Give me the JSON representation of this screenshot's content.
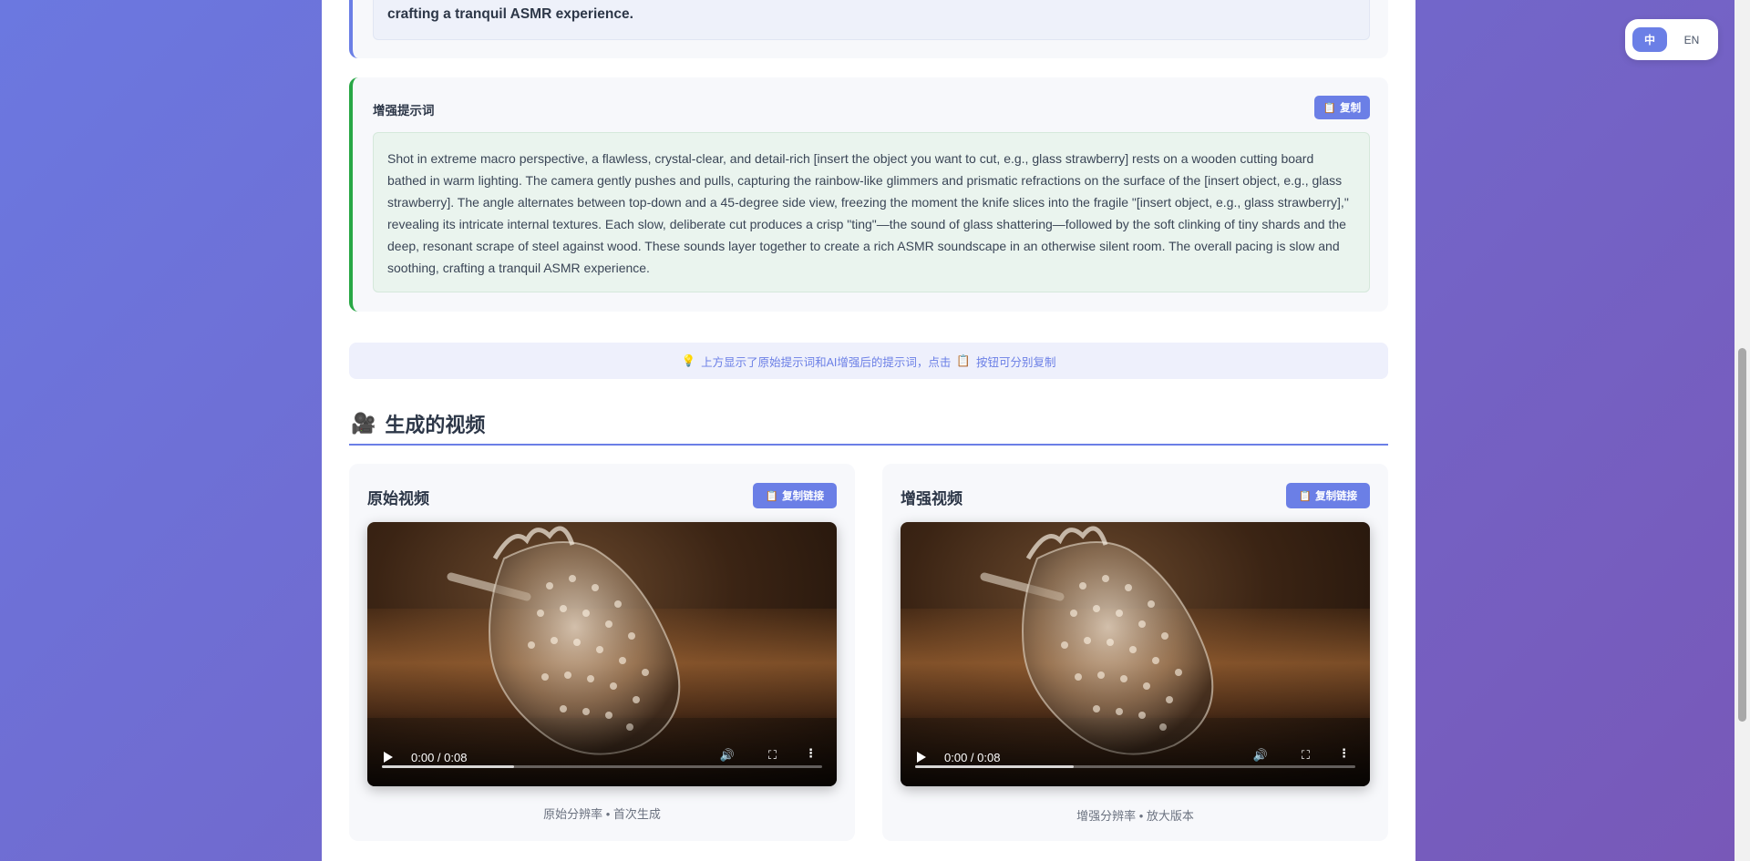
{
  "lang": {
    "zh": "中",
    "en": "EN"
  },
  "original_prompt": {
    "tail_text": "crafting a tranquil ASMR experience."
  },
  "enhanced": {
    "title": "增强提示词",
    "copy_icon": "clipboard-icon",
    "copy_label": "复制",
    "text": "Shot in extreme macro perspective, a flawless, crystal-clear, and detail-rich [insert the object you want to cut, e.g., glass strawberry] rests on a wooden cutting board bathed in warm lighting. The camera gently pushes and pulls, capturing the rainbow-like glimmers and prismatic refractions on the surface of the [insert object, e.g., glass strawberry]. The angle alternates between top-down and a 45-degree side view, freezing the moment the knife slices into the fragile \"[insert object, e.g., glass strawberry],\" revealing its intricate internal textures. Each slow, deliberate cut produces a crisp \"ting\"—the sound of glass shattering—followed by the soft clinking of tiny shards and the deep, resonant scrape of steel against wood. These sounds layer together to create a rich ASMR soundscape in an otherwise silent room. The overall pacing is slow and soothing, crafting a tranquil ASMR experience."
  },
  "hint": {
    "icon": "lightbulb-icon",
    "text_before": "上方显示了原始提示词和AI增强后的提示词，点击",
    "text_after": "按钮可分别复制"
  },
  "videos_section": {
    "icon": "video-camera-icon",
    "title": "生成的视频"
  },
  "videos": [
    {
      "title": "原始视频",
      "copy_label": "复制链接",
      "time": "0:00 / 0:08",
      "buffered": 0.3,
      "caption": "原始分辨率 • 首次生成"
    },
    {
      "title": "增强视频",
      "copy_label": "复制链接",
      "time": "0:00 / 0:08",
      "buffered": 0.36,
      "caption": "增强分辨率 • 放大版本"
    }
  ],
  "colors": {
    "accent": "#6b7fe6",
    "success": "#28a745"
  }
}
